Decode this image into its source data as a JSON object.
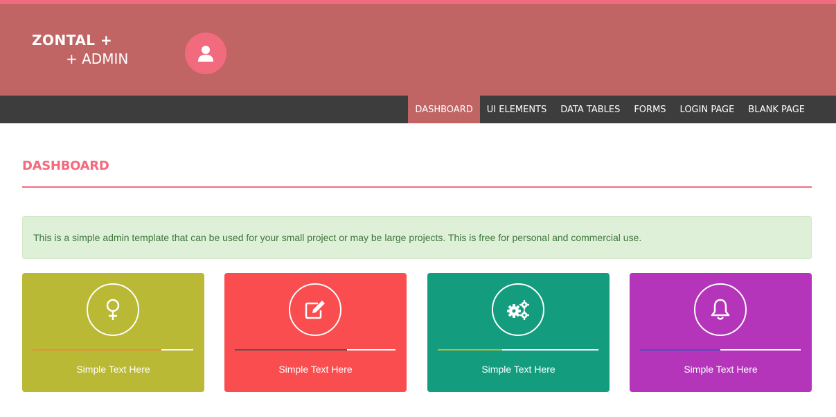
{
  "brand": {
    "line1": "ZONTAL +",
    "line2": "+ ADMIN"
  },
  "user": {
    "avatar_icon": "user-icon"
  },
  "nav": {
    "items": [
      {
        "label": "DASHBOARD",
        "active": true
      },
      {
        "label": "UI ELEMENTS",
        "active": false
      },
      {
        "label": "DATA TABLES",
        "active": false
      },
      {
        "label": "FORMS",
        "active": false
      },
      {
        "label": "LOGIN PAGE",
        "active": false
      },
      {
        "label": "BLANK PAGE",
        "active": false
      }
    ]
  },
  "page": {
    "title": "DASHBOARD"
  },
  "alert": {
    "text": "This is a simple admin template that can be used for your small project or may be large projects. This is free for personal and commercial use."
  },
  "cards": [
    {
      "icon": "female-icon",
      "text": "Simple Text Here",
      "bg": "#b9b935",
      "progress": 0.8,
      "progress_color": "#f08a3c"
    },
    {
      "icon": "edit-icon",
      "text": "Simple Text Here",
      "bg": "#f94d4f",
      "progress": 0.7,
      "progress_color": "#555555"
    },
    {
      "icon": "gears-icon",
      "text": "Simple Text Here",
      "bg": "#139d7e",
      "progress": 0.4,
      "progress_color": "#b9b935"
    },
    {
      "icon": "bell-icon",
      "text": "Simple Text Here",
      "bg": "#b435ba",
      "progress": 0.5,
      "progress_color": "#3b5bbf"
    }
  ],
  "colors": {
    "accent": "#f26a7e",
    "header": "#c06464",
    "nav": "#3d3d3d"
  }
}
